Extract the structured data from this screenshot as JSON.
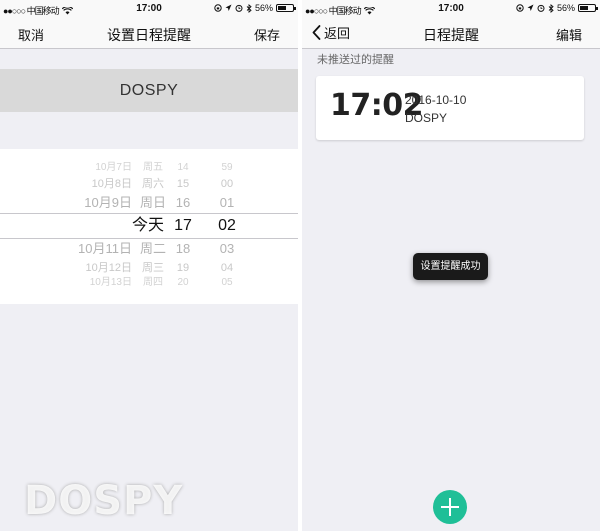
{
  "status_bar": {
    "carrier": "●●○○○ 中国移动",
    "time": "17:00",
    "battery": "56%",
    "battery_level": 0.56,
    "icons": [
      "wifi-icon",
      "rotation-lock-icon",
      "location-icon",
      "alarm-icon",
      "bluetooth-icon",
      "battery-icon"
    ]
  },
  "left_screen": {
    "nav": {
      "left": "取消",
      "title": "设置日程提醒",
      "right": "保存"
    },
    "name": "DOSPY",
    "picker_rows": [
      {
        "date": "10月7日",
        "day": "周五",
        "hour": "14",
        "minute": "59"
      },
      {
        "date": "10月8日",
        "day": "周六",
        "hour": "15",
        "minute": "00"
      },
      {
        "date": "10月9日",
        "day": "周日",
        "hour": "16",
        "minute": "01"
      },
      {
        "date": "",
        "day": "今天",
        "hour": "17",
        "minute": "02"
      },
      {
        "date": "10月11日",
        "day": "周二",
        "hour": "18",
        "minute": "03"
      },
      {
        "date": "10月12日",
        "day": "周三",
        "hour": "19",
        "minute": "04"
      },
      {
        "date": "10月13日",
        "day": "周四",
        "hour": "20",
        "minute": "05"
      }
    ],
    "watermark": "DOSPY"
  },
  "right_screen": {
    "nav": {
      "back": "返回",
      "title": "日程提醒",
      "right": "编辑"
    },
    "section_title": "未推送过的提醒",
    "reminder": {
      "time": "17:02",
      "date": "2016-10-10",
      "label": "DOSPY"
    },
    "toast": "设置提醒成功",
    "accent_color": "#1fbf97"
  }
}
